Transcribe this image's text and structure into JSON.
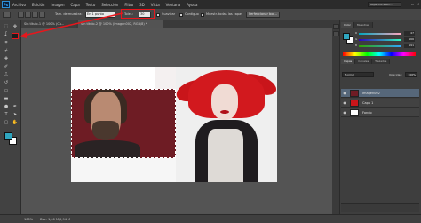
{
  "app": {
    "logo": "Ps",
    "menu": [
      "Archivo",
      "Edición",
      "Imagen",
      "Capa",
      "Texto",
      "Selección",
      "Filtro",
      "3D",
      "Vista",
      "Ventana",
      "Ayuda"
    ],
    "workspace": "Aspectos esen..."
  },
  "options_bar": {
    "sample_size_label": "Tam. de muestra:",
    "sample_size_value": "En 1 punto",
    "tolerance_label": "Toler.:",
    "tolerance_value": "30",
    "antialias_label": "Suavizar",
    "contiguous_label": "Contiguo",
    "sample_all_label": "Muestr. todas las capas",
    "refine_edge_label": "Perfeccionar bor..."
  },
  "tabs": {
    "inactive": "Sin título-1 @ 100% (Ca...",
    "active": "Sin título-2 @ 100% (Imagen002, RGB/8) *"
  },
  "tools": {
    "marquee": "⬚",
    "move": "✥",
    "lasso": "ʆ",
    "quick_select": "✎",
    "crop": "⌗",
    "eyedropper": "⌿",
    "heal": "✚",
    "brush": "✐",
    "stamp": "⎍",
    "history": "↺",
    "eraser": "▭",
    "gradient": "▬",
    "blur": "💧",
    "dodge": "●",
    "pen": "✒",
    "type": "T",
    "path": "➤",
    "shape": "▢",
    "hand": "✋",
    "zoom": "🔍"
  },
  "colors": {
    "foreground": "#2fa6bf",
    "background": "#ffffff",
    "highlight": "#e8161c"
  },
  "color_panel": {
    "tabs": [
      "Color",
      "Muestras"
    ],
    "r_label": "R",
    "g_label": "G",
    "b_label": "B",
    "r_value": "47",
    "g_value": "166",
    "b_value": "191"
  },
  "layers_panel": {
    "tabs": [
      "Capas",
      "Canales",
      "Trazados"
    ],
    "filter": "ρ Tipo",
    "blend_mode": "Normal",
    "opacity_label": "Opacidad:",
    "opacity_value": "100%",
    "fill_label": "Relleno:",
    "fill_value": "100%",
    "layers": [
      {
        "name": "Imagen002",
        "selected": true
      },
      {
        "name": "Capa 1",
        "selected": false
      },
      {
        "name": "Fondo",
        "selected": false
      }
    ]
  },
  "status": {
    "zoom": "100%",
    "doc": "Doc: 1,00 M/2,94 M"
  }
}
